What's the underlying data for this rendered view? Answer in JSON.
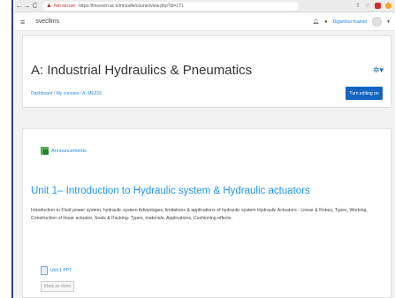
{
  "browser": {
    "nav_icons": [
      "←",
      "→",
      "C"
    ],
    "security_label": "Not secure",
    "url": "https://lmsoven.ac.in/moodle/course/view.php?id=171",
    "icons": [
      "share-icon",
      "star-icon",
      "extension-icon",
      "profile-icon"
    ],
    "ext_colors": [
      "#d32f2f",
      "#f9a825"
    ]
  },
  "navbar": {
    "site_name": "svecllms",
    "user_name": "Digambar Kashid"
  },
  "header": {
    "course_title": "A: Industrial Hydraulics & Pneumatics",
    "breadcrumb": [
      "Dashboard",
      "My courses",
      "A: ME315"
    ],
    "edit_button": "Turn editing on"
  },
  "content": {
    "announcements_label": "Announcements",
    "unit_title": "Unit 1– Introduction to Hydraulic system & Hydraulic actuators",
    "unit_description": "Introduction to Fluid power system, hydraulic system Advantages, limitations & applications of hydraulic system Hydraulic Actuators - Linear & Rotary, Types, Working, Construction of linear actuator, Seals & Packing- Types, materials, Applications, Cushioning effects.",
    "resource_label": "Unit 1 PPT",
    "mark_button": "Mark as done"
  },
  "colors": {
    "accent": "#1565c0",
    "link": "#1e88e5",
    "unit_title": "#2196f3"
  }
}
